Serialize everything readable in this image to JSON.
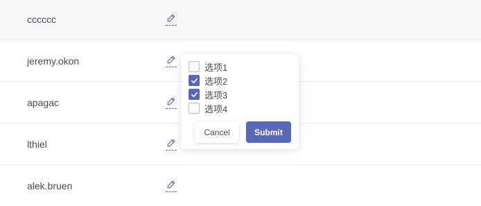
{
  "table": {
    "rows": [
      {
        "name": "cccccc"
      },
      {
        "name": "jeremy.okon"
      },
      {
        "name": "apagac"
      },
      {
        "name": "lthiel"
      },
      {
        "name": "alek.bruen"
      }
    ]
  },
  "popover": {
    "options": [
      {
        "label": "选项1",
        "checked": false
      },
      {
        "label": "选项2",
        "checked": true
      },
      {
        "label": "选项3",
        "checked": true
      },
      {
        "label": "选项4",
        "checked": false
      }
    ],
    "cancel_label": "Cancel",
    "submit_label": "Submit"
  },
  "colors": {
    "accent": "#5a68b8",
    "row_highlight": "#f7f8fa"
  },
  "icons": {
    "edit": "pencil-icon",
    "check": "check-icon"
  }
}
